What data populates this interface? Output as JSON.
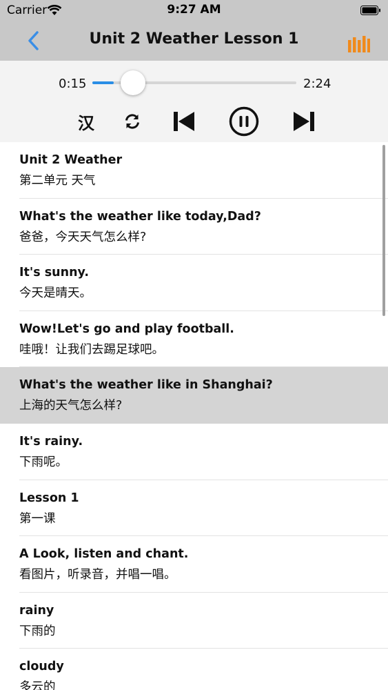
{
  "status": {
    "carrier": "Carrier",
    "time": "9:27 AM"
  },
  "nav": {
    "title": "Unit 2 Weather Lesson 1"
  },
  "player": {
    "current_time": "0:15",
    "total_time": "2:24",
    "progress_fraction": 0.104,
    "han_label": "汉",
    "accent_color": "#2a8ee6"
  },
  "icons": {
    "back": "chevron-left-icon",
    "menu": "bars-icon",
    "repeat": "repeat-icon",
    "prev": "skip-previous-icon",
    "pause": "pause-icon",
    "next": "skip-next-icon"
  },
  "colors": {
    "back": "#3a8ee6",
    "menu": "#f08a1c",
    "header_bg": "#c8c8c8",
    "player_bg": "#f3f3f3",
    "selected_row": "#d4d4d4"
  },
  "list": {
    "selected_index": 4,
    "items": [
      {
        "en": "Unit 2 Weather",
        "cn": "第二单元 天气"
      },
      {
        "en": "What's the weather like today,Dad?",
        "cn": "爸爸，今天天气怎么样?"
      },
      {
        "en": "It's sunny.",
        "cn": "今天是晴天。"
      },
      {
        "en": "Wow!Let's go and play football.",
        "cn": "哇哦！让我们去踢足球吧。"
      },
      {
        "en": "What's the weather like in Shanghai?",
        "cn": "上海的天气怎么样?"
      },
      {
        "en": "It's rainy.",
        "cn": "下雨呢。"
      },
      {
        "en": "Lesson 1",
        "cn": "第一课"
      },
      {
        "en": "A Look, listen and chant.",
        "cn": "看图片，听录音，并唱一唱。"
      },
      {
        "en": "rainy",
        "cn": "下雨的"
      },
      {
        "en": "cloudy",
        "cn": "多云的"
      }
    ]
  }
}
